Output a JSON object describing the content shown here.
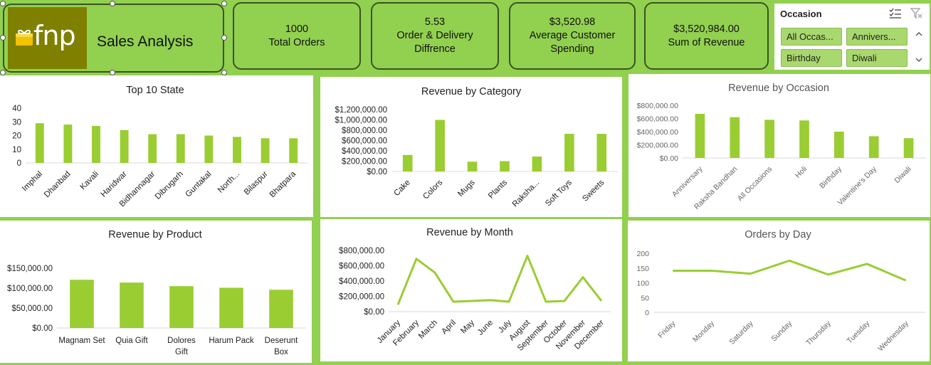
{
  "brand": {
    "logo_text": "fnp",
    "title": "Sales Analysis"
  },
  "kpis": [
    {
      "value": "1000",
      "label": "Total Orders"
    },
    {
      "value": "5.53",
      "label": "Order & Delivery",
      "label2": "Diffrence"
    },
    {
      "value": "$3,520.98",
      "label": "Average Customer",
      "label2": "Spending"
    },
    {
      "value": "$3,520,984.00",
      "label": "Sum of Revenue"
    }
  ],
  "slicer": {
    "title": "Occasion",
    "items": [
      "All Occas...",
      "Annivers...",
      "Birthday",
      "Diwali"
    ]
  },
  "colors": {
    "accent": "#92d050",
    "bar": "#9acd32",
    "border": "#3b5320"
  },
  "icons": {
    "multi_select": "multi-select-icon",
    "clear_filter": "clear-filter-icon",
    "scroll_up": "scroll-up-icon",
    "scroll_down": "scroll-down-icon"
  },
  "chart_data": [
    {
      "id": "top10state",
      "type": "bar",
      "title": "Top 10 State",
      "categories": [
        "Imphal",
        "Dhanbad",
        "Kavali",
        "Haridwar",
        "Bidhannagar",
        "Dibrugarh",
        "Guntakal",
        "North...",
        "Bilaspur",
        "Bhatpara"
      ],
      "values": [
        29,
        28,
        27,
        24,
        21,
        21,
        20,
        19,
        18,
        18
      ],
      "ylim": [
        0,
        40
      ],
      "yticks": [
        "0",
        "10",
        "20",
        "30",
        "40"
      ],
      "grid": false
    },
    {
      "id": "category",
      "type": "bar",
      "title": "Revenue by Category",
      "categories": [
        "Cake",
        "Colors",
        "Mugs",
        "Plants",
        "Raksha...",
        "Soft Toys",
        "Sweets"
      ],
      "values": [
        320000,
        1000000,
        190000,
        200000,
        290000,
        730000,
        730000
      ],
      "ylim": [
        0,
        1200000
      ],
      "yticks": [
        "$0.00",
        "$200,000.00",
        "$400,000.00",
        "$600,000.00",
        "$800,000.00",
        "$1,000,000.00",
        "$1,200,000.00"
      ],
      "grid": false
    },
    {
      "id": "occasion",
      "type": "bar",
      "title": "Revenue by Occasion",
      "categories": [
        "Anniversary",
        "Raksha Bandhan",
        "All Occasions",
        "Holi",
        "Birthday",
        "Valentine's Day",
        "Diwali"
      ],
      "values": [
        670000,
        620000,
        580000,
        570000,
        400000,
        330000,
        300000
      ],
      "ylim": [
        0,
        800000
      ],
      "yticks": [
        "$0.00",
        "$200,000.00",
        "$400,000.00",
        "$600,000.00",
        "$800,000.00"
      ],
      "grid": false
    },
    {
      "id": "product",
      "type": "bar",
      "title": "Revenue by Product",
      "categories": [
        "Magnam Set",
        "Quia Gift",
        "Dolores Gift",
        "Harum Pack",
        "Deserunt Box"
      ],
      "values": [
        121000,
        114000,
        105000,
        101000,
        96000
      ],
      "ylim": [
        0,
        150000
      ],
      "yticks": [
        "$0.00",
        "$50,000.00",
        "$100,000.00",
        "$150,000.00"
      ],
      "grid": false
    },
    {
      "id": "month",
      "type": "line",
      "title": "Revenue by Month",
      "categories": [
        "January",
        "February",
        "March",
        "April",
        "May",
        "June",
        "July",
        "August",
        "September",
        "October",
        "November",
        "December"
      ],
      "values": [
        90000,
        690000,
        510000,
        130000,
        140000,
        150000,
        130000,
        730000,
        130000,
        140000,
        450000,
        140000
      ],
      "ylim": [
        0,
        800000
      ],
      "yticks": [
        "$0.00",
        "$200,000.00",
        "$400,000.00",
        "$600,000.00",
        "$800,000.00"
      ],
      "grid": false
    },
    {
      "id": "day",
      "type": "line",
      "title": "Orders by Day",
      "categories": [
        "Friday",
        "Monday",
        "Saturday",
        "Sunday",
        "Thursday",
        "Tuesday",
        "Wednesday"
      ],
      "values": [
        141,
        141,
        131,
        175,
        128,
        164,
        108
      ],
      "ylim": [
        0,
        200
      ],
      "yticks": [
        "0",
        "50",
        "100",
        "150",
        "200"
      ],
      "grid": false
    }
  ]
}
